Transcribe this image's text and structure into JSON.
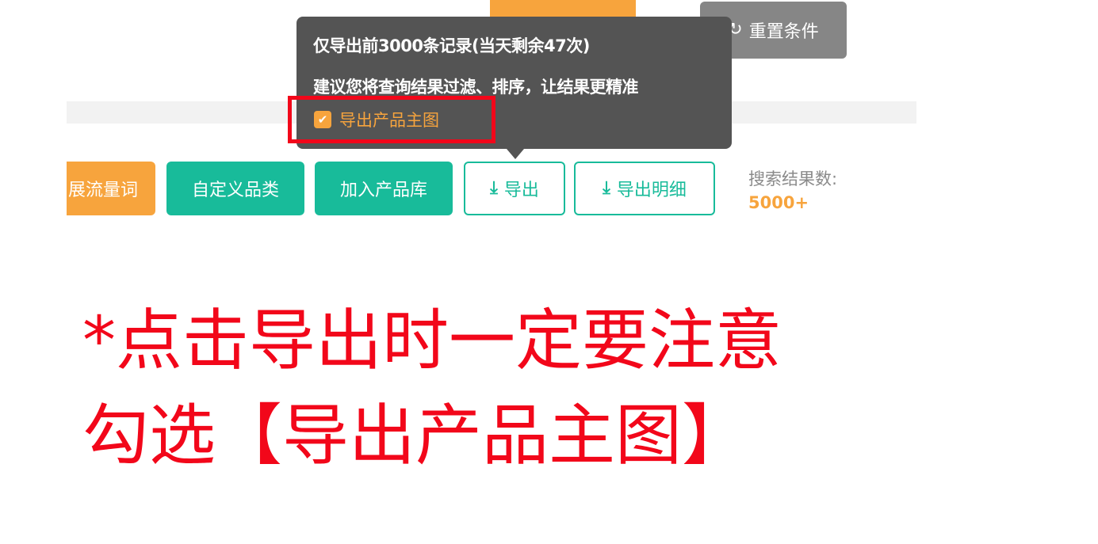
{
  "toolbar_top": {
    "reset_label": "重置条件",
    "reset_icon": "refresh-icon"
  },
  "tooltip": {
    "line1": "仅导出前3000条记录(当天剩余47次)",
    "line2": "建议您将查询结果过滤、排序，让结果更精准",
    "checkbox_label": "导出产品主图",
    "checkbox_checked": true
  },
  "actions": {
    "cut_button_label": "展流量词",
    "custom_category_label": "自定义品类",
    "add_library_label": "加入产品库",
    "export_label": "导出",
    "export_detail_label": "导出明细",
    "download_icon": "download-icon"
  },
  "results": {
    "label": "搜索结果数:",
    "count": "5000+"
  },
  "note": {
    "line1": "*点击导出时一定要注意",
    "line2": "勾选【导出产品主图】"
  },
  "colors": {
    "orange": "#f7a43d",
    "teal": "#18bb9a",
    "tooltip_bg": "#545454",
    "highlight_red": "#f2071a",
    "reset_grey": "#868686"
  }
}
